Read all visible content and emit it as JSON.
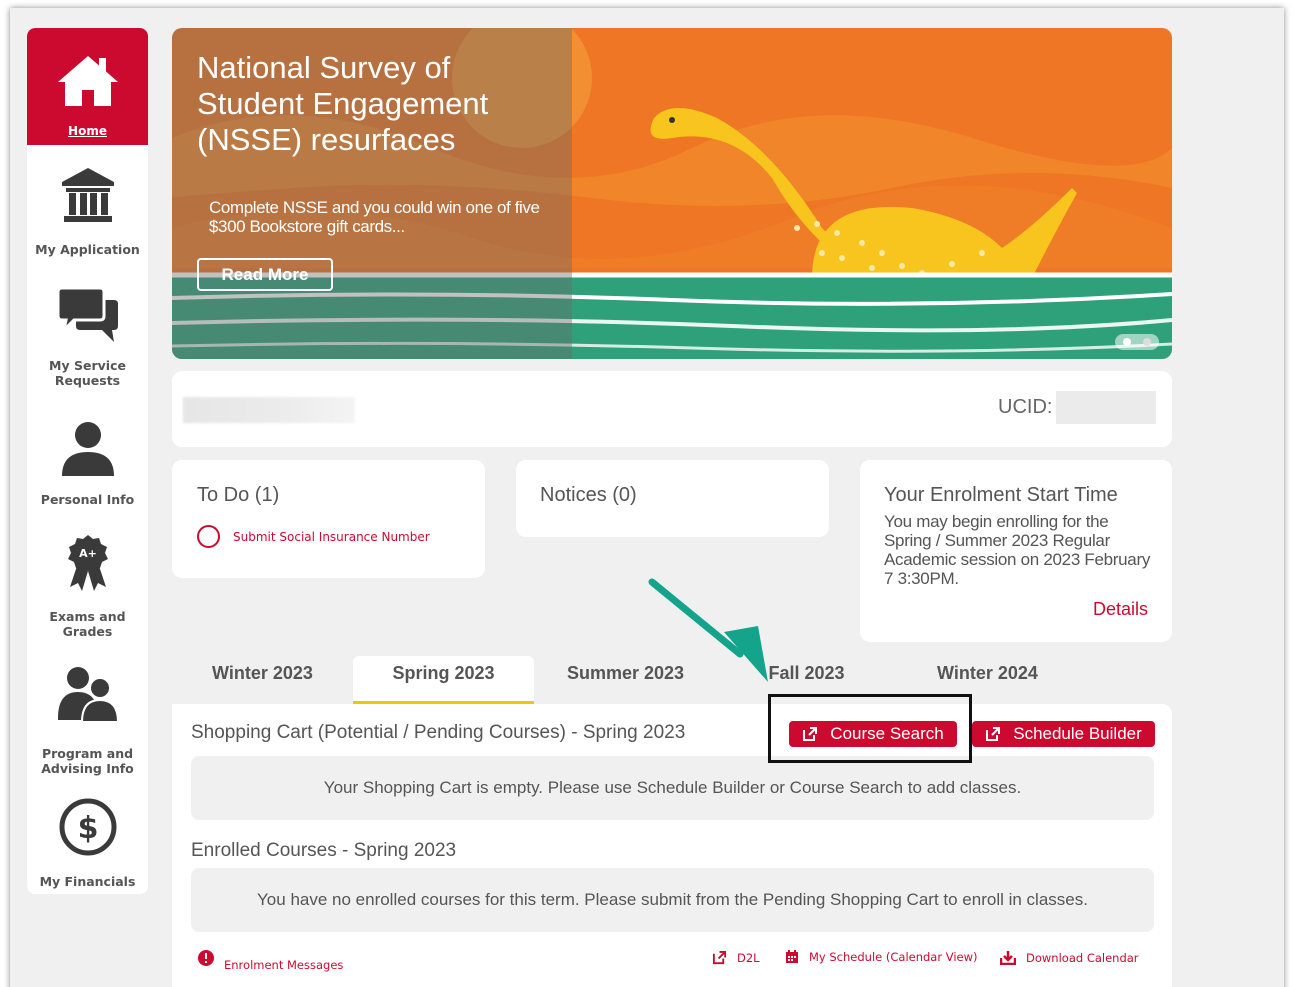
{
  "colors": {
    "brand_red": "#cc0a2f",
    "tab_accent": "#f5c400",
    "banner_orange": "#ee7624",
    "arrow": "#14a38b"
  },
  "sidebar": {
    "items": [
      {
        "label": "Home",
        "icon": "home-icon",
        "active": true
      },
      {
        "label": "My Application",
        "icon": "institution-icon"
      },
      {
        "label_lines": [
          "My Service",
          "Requests"
        ],
        "icon": "chat-bubbles-icon"
      },
      {
        "label": "Personal Info",
        "icon": "person-icon"
      },
      {
        "label_lines": [
          "Exams and",
          "Grades"
        ],
        "icon": "award-ribbon-icon"
      },
      {
        "label_lines": [
          "Program and",
          "Advising Info"
        ],
        "icon": "advisor-icon"
      },
      {
        "label": "My Financials",
        "icon": "dollar-circle-icon"
      }
    ]
  },
  "banner": {
    "title": "National Survey of Student Engagement (NSSE) resurfaces",
    "description": "Complete NSSE and you could win one of five $300 Bookstore gift cards...",
    "button_label": "Read More"
  },
  "identity": {
    "ucid_label": "UCID:"
  },
  "todo": {
    "title": "To Do (1)",
    "items": [
      "Submit Social Insurance Number"
    ]
  },
  "notices": {
    "title": "Notices (0)"
  },
  "enrolment": {
    "title": "Your Enrolment Start Time",
    "body": "You may begin enrolling for the Spring / Summer 2023 Regular Academic session on 2023 February 7 3:30PM.",
    "details_label": "Details"
  },
  "tabs": [
    {
      "label": "Winter 2023"
    },
    {
      "label": "Spring 2023",
      "active": true
    },
    {
      "label": "Summer 2023"
    },
    {
      "label": "Fall 2023"
    },
    {
      "label": "Winter 2024"
    }
  ],
  "shopping_cart": {
    "title": "Shopping Cart (Potential / Pending Courses) - Spring 2023",
    "empty_message": "Your Shopping Cart is empty. Please use Schedule Builder or Course Search to add classes.",
    "course_search_label": "Course Search",
    "schedule_builder_label": "Schedule Builder"
  },
  "enrolled": {
    "title": "Enrolled Courses - Spring 2023",
    "empty_message": "You have no enrolled courses for this term. Please submit from the Pending Shopping Cart to enroll in classes."
  },
  "footer": {
    "enrolment_messages": "Enrolment Messages",
    "d2l": "D2L",
    "my_schedule": "My Schedule (Calendar View)",
    "download_calendar": "Download Calendar"
  }
}
